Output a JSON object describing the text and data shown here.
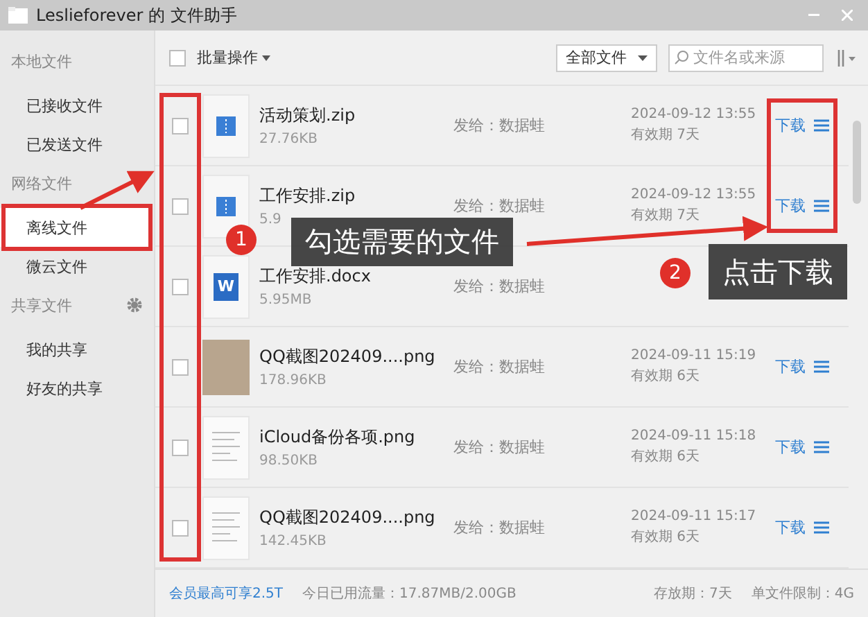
{
  "window": {
    "title": "Leslieforever 的 文件助手"
  },
  "sidebar": {
    "groups": [
      {
        "header": "本地文件",
        "items": [
          {
            "label": "已接收文件",
            "selected": false
          },
          {
            "label": "已发送文件",
            "selected": false
          }
        ]
      },
      {
        "header": "网络文件",
        "items": [
          {
            "label": "离线文件",
            "selected": true
          },
          {
            "label": "微云文件",
            "selected": false
          }
        ]
      },
      {
        "header": "共享文件",
        "settings": true,
        "items": [
          {
            "label": "我的共享",
            "selected": false
          },
          {
            "label": "好友的共享",
            "selected": false
          }
        ]
      }
    ]
  },
  "toolbar": {
    "select_all": {
      "checked": false
    },
    "batch": "批量操作",
    "filter": "全部文件",
    "search": {
      "placeholder": "文件名或来源"
    }
  },
  "files": [
    {
      "kind": "zip",
      "checked": false,
      "name": "活动策划.zip",
      "size": "27.76KB",
      "sender": "发给：数据蛙",
      "date": "2024-09-12 13:55",
      "expiry": "有效期 7天",
      "download": "下载"
    },
    {
      "kind": "zip",
      "checked": false,
      "name": "工作安排.zip",
      "size": "5.9",
      "sender": "发给：数据蛙",
      "date": "2024-09-12 13:55",
      "expiry": "有效期 7天",
      "download": "下载"
    },
    {
      "kind": "word",
      "icon_text": "W",
      "checked": false,
      "name": "工作安排.docx",
      "size": "5.95MB",
      "sender": "发给：数据蛙"
    },
    {
      "kind": "photo",
      "checked": false,
      "name": "QQ截图202409....png",
      "size": "178.96KB",
      "sender": "发给：数据蛙",
      "date": "2024-09-11 15:19",
      "expiry": "有效期 6天",
      "download": "下载"
    },
    {
      "kind": "document",
      "checked": false,
      "name": "iCloud备份各项.png",
      "size": "98.50KB",
      "sender": "发给：数据蛙",
      "date": "2024-09-11 15:18",
      "expiry": "有效期 6天",
      "download": "下载"
    },
    {
      "kind": "document",
      "checked": false,
      "name": "QQ截图202409....png",
      "size": "142.45KB",
      "sender": "发给：数据蛙",
      "date": "2024-09-11 15:17",
      "expiry": "有效期 6天",
      "download": "下载"
    }
  ],
  "status_bar": {
    "link": "会员最高可享2.5T",
    "traffic": "今日已用流量：17.87MB/2.00GB",
    "retention": "存放期：7天",
    "limit": "单文件限制：4G"
  },
  "annotations": [
    {
      "number": "1",
      "text": "勾选需要的文件"
    },
    {
      "number": "2",
      "text": "点击下载"
    }
  ]
}
